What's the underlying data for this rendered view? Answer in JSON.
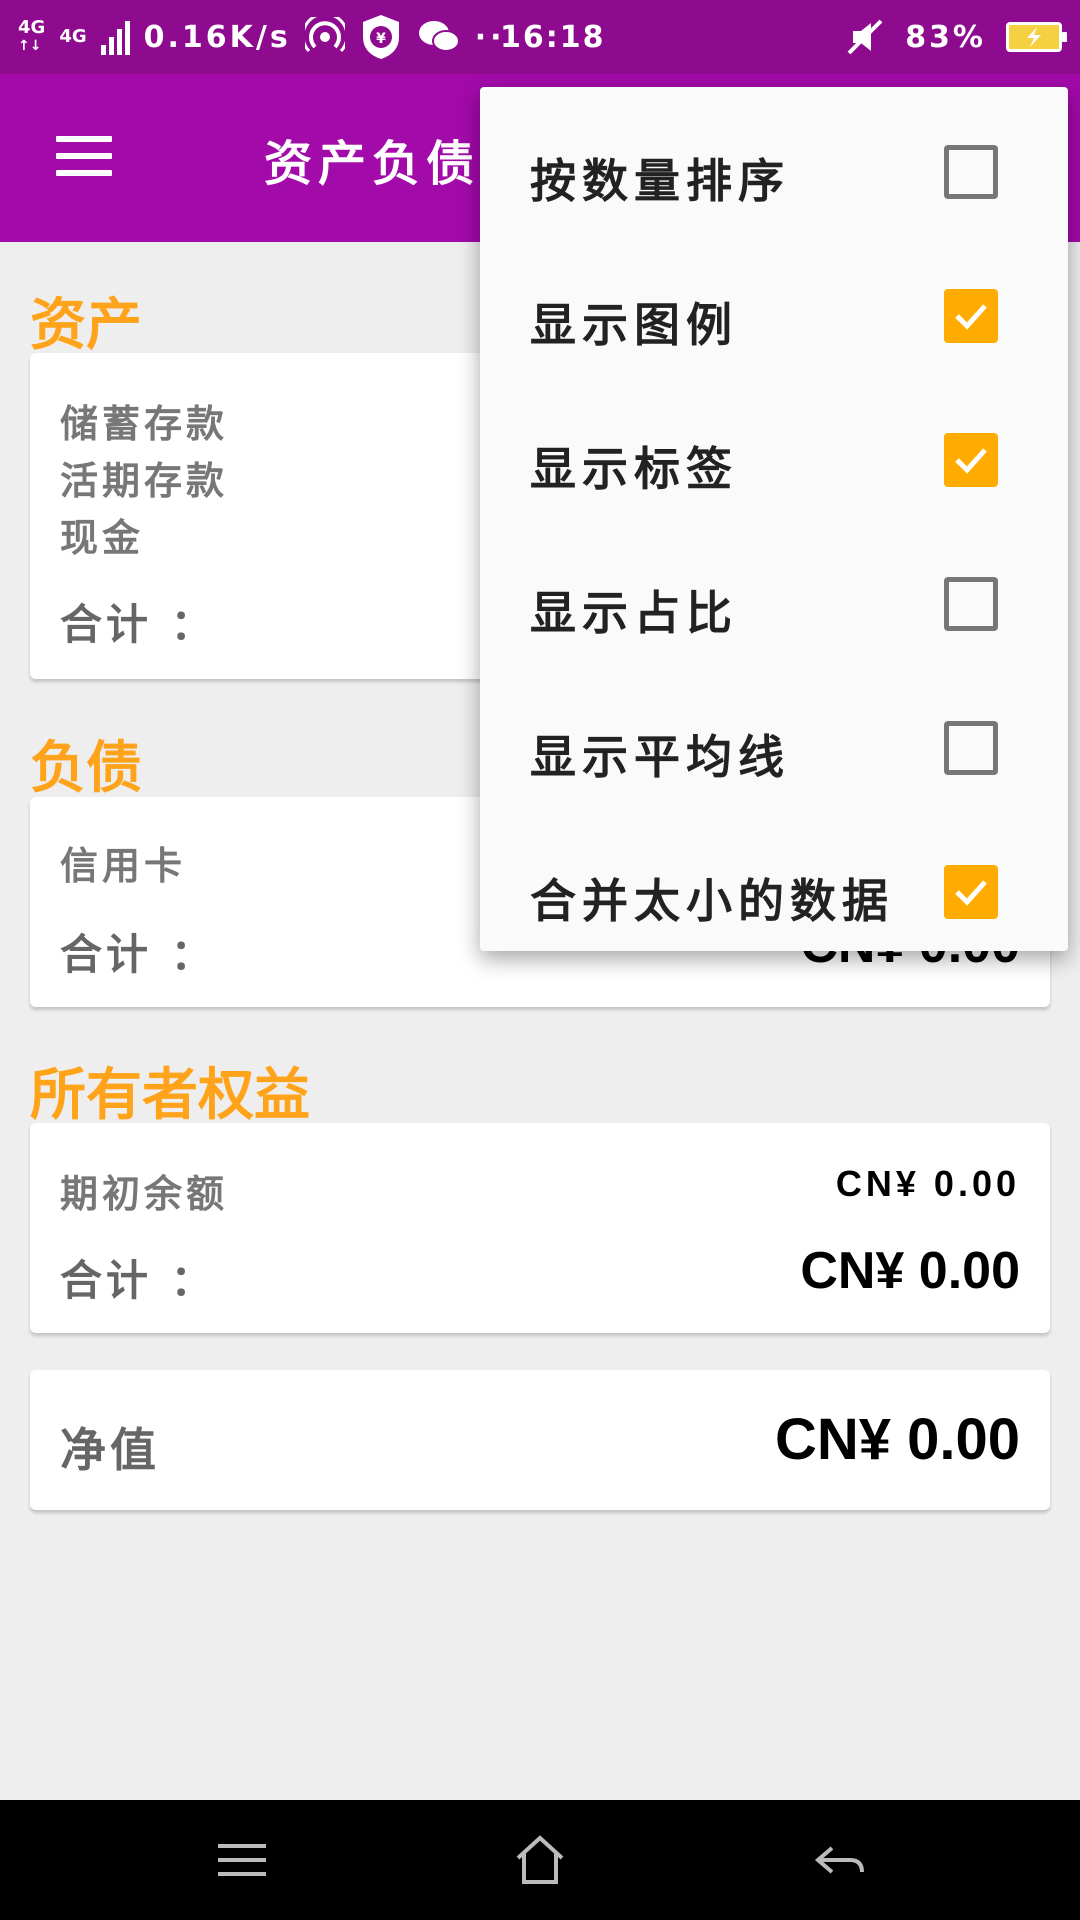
{
  "status_bar": {
    "network_a": "4G",
    "network_b": "4G",
    "speed": "0.16K/s",
    "time": "16:18",
    "battery": "83%"
  },
  "app_bar": {
    "title": "资产负债"
  },
  "sections": {
    "assets": {
      "title": "资产",
      "items": [
        "储蓄存款",
        "活期存款",
        "现金"
      ],
      "total_label": "合计 ："
    },
    "liabilities": {
      "title": "负债",
      "items": [
        "信用卡"
      ],
      "total_label": "合计 ：",
      "total_value": "CN¥ 0.00"
    },
    "equity": {
      "title": "所有者权益",
      "items": [
        {
          "label": "期初余额",
          "value": "CN¥ 0.00"
        }
      ],
      "total_label": "合计 ：",
      "total_value": "CN¥ 0.00"
    },
    "net_worth": {
      "label": "净值",
      "value": "CN¥ 0.00"
    }
  },
  "popup_menu": {
    "items": [
      {
        "label": "按数量排序",
        "checked": false
      },
      {
        "label": "显示图例",
        "checked": true
      },
      {
        "label": "显示标签",
        "checked": true
      },
      {
        "label": "显示占比",
        "checked": false
      },
      {
        "label": "显示平均线",
        "checked": false
      },
      {
        "label": "合并太小的数据",
        "checked": true
      }
    ]
  },
  "colors": {
    "status_bar": "#8e0a8e",
    "app_bar": "#a20aaa",
    "section_title": "#ffa31a",
    "checkbox_checked": "#ffab00"
  }
}
